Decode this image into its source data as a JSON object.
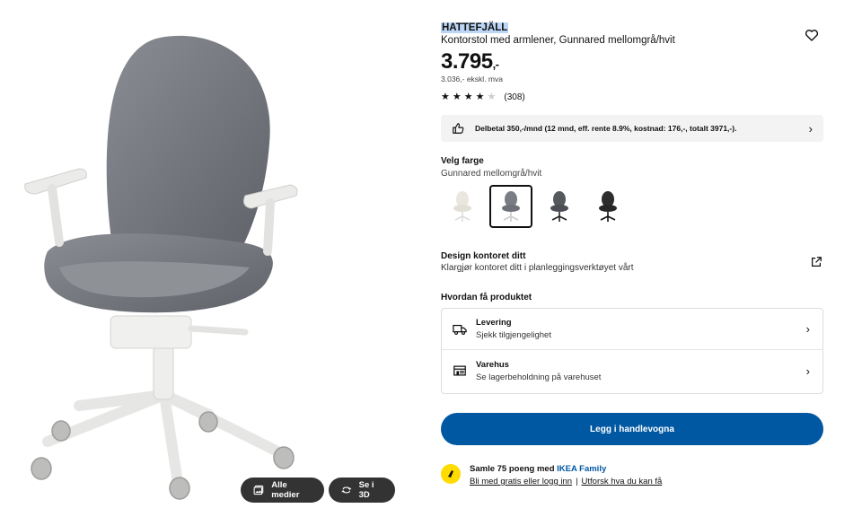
{
  "gallery": {
    "all_media_label": "Alle medier",
    "view_3d_label": "Se i 3D"
  },
  "product": {
    "name": "HATTEFJÄLL",
    "description": "Kontorstol med armlener, Gunnared mellomgrå/hvit",
    "price_main": "3.795",
    "price_suffix": ",-",
    "price_ex_vat": "3.036,- ekskl. mva",
    "rating_value": 4,
    "rating_max": 5,
    "review_count": "(308)"
  },
  "finance": {
    "text": "Delbetal 350,-/mnd (12 mnd, eff. rente 8.9%, kostnad: 176,-, totalt 3971,-)."
  },
  "color": {
    "title": "Velg farge",
    "selected": "Gunnared mellomgrå/hvit",
    "options": [
      "beige/white",
      "mediumgrey/white",
      "darkgrey/black",
      "black"
    ]
  },
  "design": {
    "title": "Design kontoret ditt",
    "subtitle": "Klargjør kontoret ditt i planleggingsverktøyet vårt"
  },
  "delivery": {
    "title": "Hvordan få produktet",
    "rows": [
      {
        "title": "Levering",
        "sub": "Sjekk tilgjengelighet",
        "icon": "truck-icon"
      },
      {
        "title": "Varehus",
        "sub": "Se lagerbeholdning på varehuset",
        "icon": "store-icon"
      }
    ]
  },
  "cart": {
    "label": "Legg i handlevogna"
  },
  "family": {
    "line1_prefix": "Samle 75 poeng med ",
    "line1_brand": "IKEA Family",
    "link_join": "Bli med gratis eller logg inn",
    "separator": "|",
    "link_more": "Utforsk hva du kan få"
  },
  "colors": {
    "accent": "#0058a3",
    "family_yellow": "#ffdb00",
    "finance_bg": "#f3f3f3",
    "selection_highlight": "#bcd6f5"
  }
}
